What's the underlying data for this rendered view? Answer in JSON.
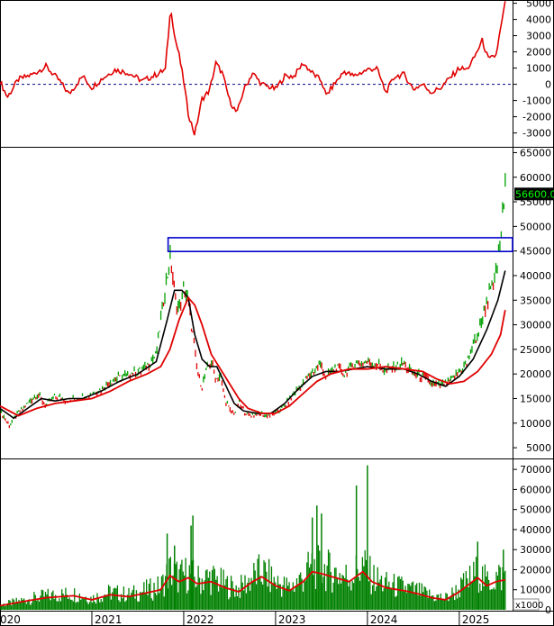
{
  "chart_data": [
    {
      "type": "line",
      "panel": "oscillator",
      "ylim": [
        -3800,
        5200
      ],
      "yticks": [
        5000,
        4000,
        3000,
        2000,
        1000,
        0,
        -1000,
        -2000,
        -3000
      ],
      "zero_line": true,
      "colors": {
        "line": "#e00000",
        "zero": "#000080"
      },
      "series": [
        {
          "points": [
            [
              2020.0,
              200
            ],
            [
              2020.08,
              -800
            ],
            [
              2020.2,
              300
            ],
            [
              2020.35,
              600
            ],
            [
              2020.5,
              1100
            ],
            [
              2020.65,
              200
            ],
            [
              2020.75,
              -600
            ],
            [
              2020.9,
              500
            ],
            [
              2021.0,
              -200
            ],
            [
              2021.1,
              300
            ],
            [
              2021.25,
              900
            ],
            [
              2021.4,
              700
            ],
            [
              2021.55,
              200
            ],
            [
              2021.7,
              600
            ],
            [
              2021.8,
              900
            ],
            [
              2021.86,
              4800
            ],
            [
              2021.9,
              3000
            ],
            [
              2021.95,
              1800
            ],
            [
              2022.0,
              200
            ],
            [
              2022.05,
              -1800
            ],
            [
              2022.12,
              -3100
            ],
            [
              2022.2,
              -900
            ],
            [
              2022.28,
              -400
            ],
            [
              2022.35,
              1300
            ],
            [
              2022.42,
              700
            ],
            [
              2022.5,
              -1000
            ],
            [
              2022.58,
              -1800
            ],
            [
              2022.65,
              -400
            ],
            [
              2022.75,
              700
            ],
            [
              2022.85,
              0
            ],
            [
              2023.0,
              -300
            ],
            [
              2023.1,
              500
            ],
            [
              2023.2,
              500
            ],
            [
              2023.3,
              1300
            ],
            [
              2023.4,
              700
            ],
            [
              2023.5,
              200
            ],
            [
              2023.55,
              -700
            ],
            [
              2023.65,
              100
            ],
            [
              2023.75,
              800
            ],
            [
              2023.85,
              500
            ],
            [
              2024.0,
              900
            ],
            [
              2024.1,
              1000
            ],
            [
              2024.2,
              -500
            ],
            [
              2024.3,
              500
            ],
            [
              2024.4,
              600
            ],
            [
              2024.5,
              -300
            ],
            [
              2024.6,
              0
            ],
            [
              2024.7,
              -500
            ],
            [
              2024.8,
              -200
            ],
            [
              2024.9,
              400
            ],
            [
              2025.0,
              1000
            ],
            [
              2025.08,
              900
            ],
            [
              2025.15,
              1500
            ],
            [
              2025.25,
              2700
            ],
            [
              2025.32,
              1500
            ],
            [
              2025.4,
              1800
            ],
            [
              2025.5,
              5000
            ]
          ]
        }
      ]
    },
    {
      "type": "line",
      "panel": "price",
      "ylim": [
        3000,
        66000
      ],
      "yticks": [
        65000,
        60000,
        55000,
        50000,
        45000,
        40000,
        35000,
        30000,
        25000,
        20000,
        15000,
        10000,
        5000
      ],
      "last_price_label": "56600.00",
      "highlight_box": {
        "x_start": 2021.83,
        "x_end": 2025.58,
        "y_low": 44900,
        "y_high": 47700,
        "color": "#0000cc"
      },
      "colors": {
        "price_up": "#00a000",
        "price_down": "#e00000",
        "ma_short": "#000000",
        "ma_long": "#e00000"
      },
      "series": [
        {
          "points": [
            [
              2020.0,
              12500
            ],
            [
              2020.1,
              9500
            ],
            [
              2020.2,
              12000
            ],
            [
              2020.3,
              14000
            ],
            [
              2020.4,
              16000
            ],
            [
              2020.5,
              13500
            ],
            [
              2020.6,
              15500
            ],
            [
              2020.75,
              14500
            ],
            [
              2020.9,
              15500
            ],
            [
              2021.0,
              16000
            ],
            [
              2021.1,
              17000
            ],
            [
              2021.2,
              18500
            ],
            [
              2021.35,
              19500
            ],
            [
              2021.5,
              20500
            ],
            [
              2021.6,
              21500
            ],
            [
              2021.7,
              24000
            ],
            [
              2021.78,
              35000
            ],
            [
              2021.82,
              40000
            ],
            [
              2021.86,
              44000
            ],
            [
              2021.9,
              36000
            ],
            [
              2021.95,
              33000
            ],
            [
              2022.0,
              37000
            ],
            [
              2022.05,
              35000
            ],
            [
              2022.1,
              28000
            ],
            [
              2022.15,
              20000
            ],
            [
              2022.2,
              17500
            ],
            [
              2022.25,
              21000
            ],
            [
              2022.3,
              22500
            ],
            [
              2022.35,
              19000
            ],
            [
              2022.4,
              19500
            ],
            [
              2022.45,
              15000
            ],
            [
              2022.5,
              12500
            ],
            [
              2022.55,
              12000
            ],
            [
              2022.6,
              14000
            ],
            [
              2022.7,
              11500
            ],
            [
              2022.8,
              12000
            ],
            [
              2022.9,
              11500
            ],
            [
              2023.0,
              12000
            ],
            [
              2023.1,
              13500
            ],
            [
              2023.2,
              16000
            ],
            [
              2023.3,
              18000
            ],
            [
              2023.4,
              20500
            ],
            [
              2023.5,
              22000
            ],
            [
              2023.55,
              19000
            ],
            [
              2023.65,
              21500
            ],
            [
              2023.75,
              20000
            ],
            [
              2023.85,
              22000
            ],
            [
              2024.0,
              22500
            ],
            [
              2024.1,
              22000
            ],
            [
              2024.2,
              20500
            ],
            [
              2024.3,
              21500
            ],
            [
              2024.4,
              22000
            ],
            [
              2024.5,
              20000
            ],
            [
              2024.6,
              19500
            ],
            [
              2024.7,
              18000
            ],
            [
              2024.8,
              17500
            ],
            [
              2024.9,
              18500
            ],
            [
              2025.0,
              20500
            ],
            [
              2025.08,
              22000
            ],
            [
              2025.15,
              26000
            ],
            [
              2025.22,
              29000
            ],
            [
              2025.3,
              35000
            ],
            [
              2025.38,
              38000
            ],
            [
              2025.45,
              48000
            ],
            [
              2025.5,
              56600
            ]
          ]
        },
        {
          "points": [
            [
              2020.0,
              13000
            ],
            [
              2020.15,
              11000
            ],
            [
              2020.3,
              13000
            ],
            [
              2020.45,
              15000
            ],
            [
              2020.6,
              14500
            ],
            [
              2020.75,
              15000
            ],
            [
              2020.9,
              15000
            ],
            [
              2021.1,
              16500
            ],
            [
              2021.3,
              18500
            ],
            [
              2021.5,
              20000
            ],
            [
              2021.7,
              22500
            ],
            [
              2021.82,
              31000
            ],
            [
              2021.9,
              37000
            ],
            [
              2021.98,
              37000
            ],
            [
              2022.05,
              35500
            ],
            [
              2022.12,
              28000
            ],
            [
              2022.2,
              23000
            ],
            [
              2022.28,
              21500
            ],
            [
              2022.36,
              21500
            ],
            [
              2022.45,
              18000
            ],
            [
              2022.55,
              14000
            ],
            [
              2022.65,
              12500
            ],
            [
              2022.8,
              12000
            ],
            [
              2022.95,
              12000
            ],
            [
              2023.1,
              14000
            ],
            [
              2023.25,
              17000
            ],
            [
              2023.4,
              19500
            ],
            [
              2023.55,
              20500
            ],
            [
              2023.7,
              20500
            ],
            [
              2023.85,
              21000
            ],
            [
              2024.0,
              21500
            ],
            [
              2024.2,
              21000
            ],
            [
              2024.4,
              21000
            ],
            [
              2024.55,
              20000
            ],
            [
              2024.7,
              18500
            ],
            [
              2024.85,
              17500
            ],
            [
              2025.0,
              19500
            ],
            [
              2025.15,
              23000
            ],
            [
              2025.3,
              29000
            ],
            [
              2025.42,
              35000
            ],
            [
              2025.5,
              41000
            ]
          ]
        },
        {
          "points": [
            [
              2020.0,
              13500
            ],
            [
              2020.2,
              11500
            ],
            [
              2020.4,
              13000
            ],
            [
              2020.6,
              14000
            ],
            [
              2020.8,
              14500
            ],
            [
              2021.0,
              15000
            ],
            [
              2021.2,
              16500
            ],
            [
              2021.4,
              18500
            ],
            [
              2021.6,
              20000
            ],
            [
              2021.75,
              21500
            ],
            [
              2021.85,
              25000
            ],
            [
              2021.95,
              31000
            ],
            [
              2022.05,
              35500
            ],
            [
              2022.12,
              34000
            ],
            [
              2022.2,
              30000
            ],
            [
              2022.3,
              24000
            ],
            [
              2022.4,
              21000
            ],
            [
              2022.5,
              18000
            ],
            [
              2022.6,
              15000
            ],
            [
              2022.7,
              13000
            ],
            [
              2022.85,
              12000
            ],
            [
              2023.0,
              12000
            ],
            [
              2023.15,
              13500
            ],
            [
              2023.3,
              16000
            ],
            [
              2023.45,
              18500
            ],
            [
              2023.6,
              20000
            ],
            [
              2023.8,
              21000
            ],
            [
              2024.0,
              21000
            ],
            [
              2024.2,
              21500
            ],
            [
              2024.4,
              21000
            ],
            [
              2024.6,
              20500
            ],
            [
              2024.75,
              19000
            ],
            [
              2024.9,
              18000
            ],
            [
              2025.05,
              18500
            ],
            [
              2025.2,
              20500
            ],
            [
              2025.35,
              24000
            ],
            [
              2025.45,
              28000
            ],
            [
              2025.5,
              33000
            ]
          ]
        }
      ]
    },
    {
      "type": "bar",
      "panel": "volume",
      "ylim": [
        0,
        75000
      ],
      "yticks": [
        70000,
        60000,
        50000,
        40000,
        30000,
        20000,
        10000,
        0
      ],
      "unit_label": "x1000",
      "colors": {
        "bars": "#008000",
        "ma": "#e00000"
      },
      "spikes": [
        [
          2021.82,
          38000
        ],
        [
          2021.9,
          32000
        ],
        [
          2022.08,
          42000
        ],
        [
          2022.1,
          47000
        ],
        [
          2023.4,
          46000
        ],
        [
          2023.45,
          52000
        ],
        [
          2023.5,
          48000
        ],
        [
          2023.88,
          62000
        ],
        [
          2024.0,
          72000
        ],
        [
          2025.2,
          34000
        ],
        [
          2025.48,
          30000
        ]
      ],
      "series": [
        {
          "points": [
            [
              2020.0,
              2000
            ],
            [
              2020.3,
              4500
            ],
            [
              2020.5,
              6000
            ],
            [
              2020.8,
              7000
            ],
            [
              2021.0,
              5000
            ],
            [
              2021.2,
              7500
            ],
            [
              2021.4,
              6500
            ],
            [
              2021.6,
              8500
            ],
            [
              2021.75,
              10000
            ],
            [
              2021.85,
              17000
            ],
            [
              2021.95,
              14000
            ],
            [
              2022.05,
              16000
            ],
            [
              2022.15,
              13000
            ],
            [
              2022.3,
              14000
            ],
            [
              2022.45,
              11000
            ],
            [
              2022.6,
              9000
            ],
            [
              2022.75,
              14000
            ],
            [
              2022.85,
              16500
            ],
            [
              2023.0,
              12000
            ],
            [
              2023.15,
              9500
            ],
            [
              2023.3,
              14000
            ],
            [
              2023.4,
              19000
            ],
            [
              2023.5,
              18000
            ],
            [
              2023.65,
              16000
            ],
            [
              2023.8,
              14000
            ],
            [
              2023.95,
              19000
            ],
            [
              2024.05,
              14000
            ],
            [
              2024.2,
              11000
            ],
            [
              2024.4,
              9500
            ],
            [
              2024.55,
              8000
            ],
            [
              2024.7,
              6000
            ],
            [
              2024.85,
              5000
            ],
            [
              2025.0,
              9000
            ],
            [
              2025.1,
              12500
            ],
            [
              2025.2,
              16000
            ],
            [
              2025.3,
              12000
            ],
            [
              2025.4,
              14000
            ],
            [
              2025.5,
              15000
            ]
          ]
        }
      ]
    }
  ],
  "x_axis": {
    "range": [
      2020.0,
      2025.58
    ],
    "labels": [
      "020",
      "2021",
      "2022",
      "2023",
      "2024",
      "2025"
    ],
    "ticks": [
      2020.0,
      2021.0,
      2022.0,
      2023.0,
      2024.0,
      2025.0
    ]
  }
}
